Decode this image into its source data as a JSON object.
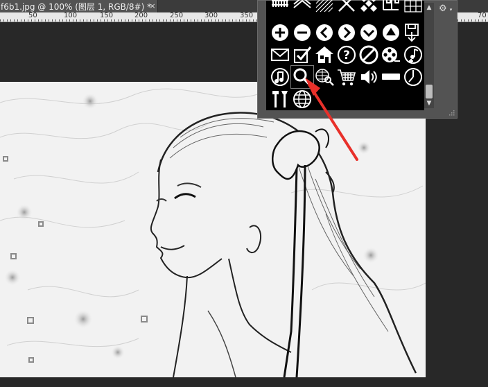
{
  "document": {
    "tab_title": "f6b1.jpg @ 100% (图层 1, RGB/8#) *",
    "close_glyph": "×"
  },
  "ruler": {
    "labels": [
      "50",
      "100",
      "150",
      "200",
      "250",
      "300",
      "350",
      "70"
    ]
  },
  "shape_picker": {
    "gear_glyph": "⚙",
    "scroll_up_glyph": "▲",
    "scroll_down_glyph": "▼",
    "selected_shape": "search-magnifier",
    "shapes": [
      "fence",
      "roof-stripes",
      "diagonal-hatch",
      "cross-x",
      "checker-diamonds",
      "greek-key",
      "grid",
      "plus-circle",
      "minus-circle",
      "left-arrow-circle",
      "right-arrow-circle",
      "down-arrow-circle",
      "up-arrow-circle",
      "save-disk",
      "envelope",
      "checkbox",
      "home",
      "question-circle",
      "no-entry-circle",
      "film-reel",
      "music-plus",
      "music-note-circle",
      "search-magnifier",
      "web-search",
      "shopping-cart",
      "speaker",
      "minus-bar",
      "clock",
      "tools",
      "globe"
    ]
  },
  "annotation": {
    "color": "#e8302a"
  }
}
